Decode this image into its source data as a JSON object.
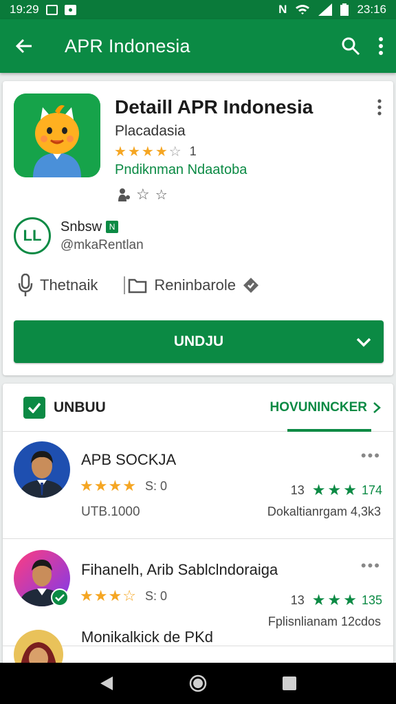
{
  "status_bar": {
    "time": "19:29",
    "clock": "23:16"
  },
  "app_bar": {
    "title": "APR Indonesia"
  },
  "app": {
    "name": "Detaill APR Indonesia",
    "developer": "Placadasia",
    "rating_count": "1",
    "category": "Pndiknman Ndaatoba"
  },
  "developer": {
    "logo_text": "LL",
    "name": "Snbsw",
    "badge": "N",
    "handle": "@mkaRentlan"
  },
  "meta": {
    "left": "Thetnaik",
    "right": "Reninbarole"
  },
  "install": {
    "label": "UNDJU"
  },
  "reviews_tab": {
    "left_label": "UNBUU",
    "right_label": "HOVUNINCKER"
  },
  "reviews": [
    {
      "name": "APB SOCKJA",
      "score": "S: 0",
      "sub": "UTB.1000",
      "right_num": "13",
      "right_count": "174",
      "right_sub": "Dokaltianrgam 4,3k3",
      "stars": 4
    },
    {
      "name": "Fihanelh, Arib Sablclndoraiga",
      "score": "S: 0",
      "right_num": "13",
      "right_count": "135",
      "right_sub": "Fplisnlianam 12cdos",
      "stars": 3
    },
    {
      "name": "Monikalkick de PKd",
      "sub": ""
    }
  ],
  "colors": {
    "primary": "#0b8a44",
    "status": "#0a7a3a",
    "star": "#f5a623"
  }
}
